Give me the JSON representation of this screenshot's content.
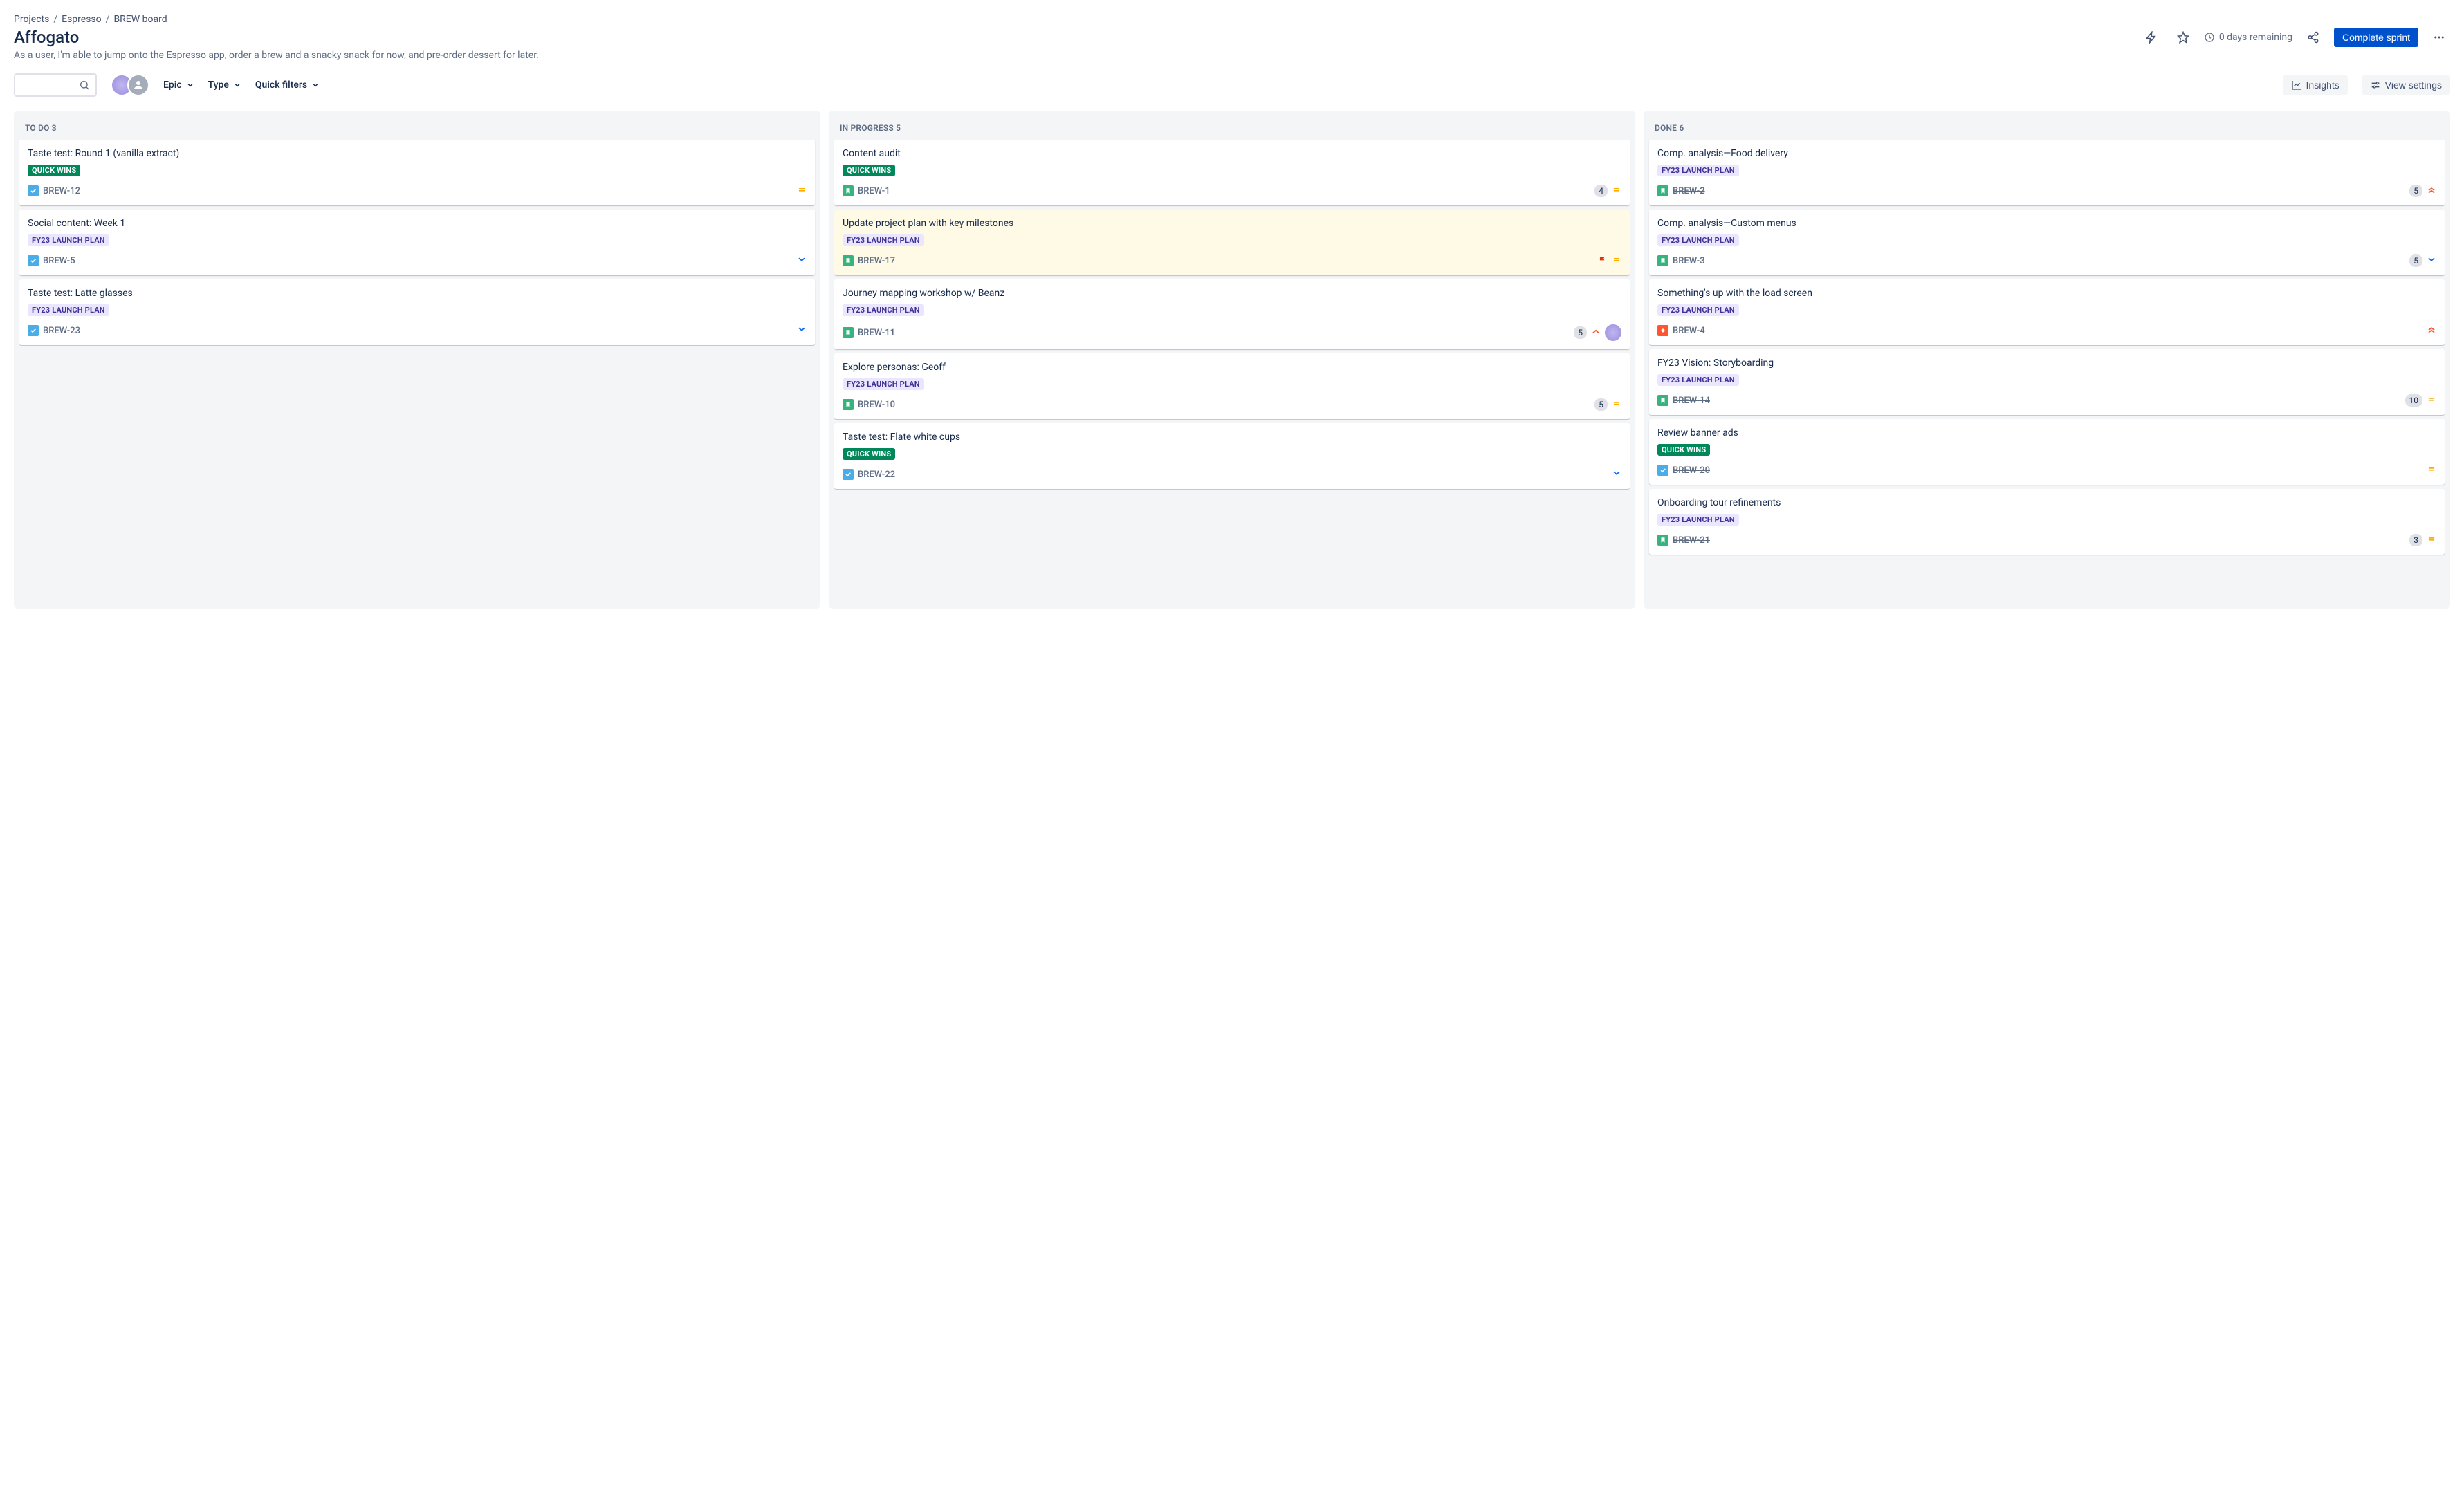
{
  "breadcrumbs": {
    "root": "Projects",
    "project": "Espresso",
    "board": "BREW board"
  },
  "sprint": {
    "name": "Affogato",
    "goal": "As a user, I'm able to jump onto the Espresso app, order a brew and a snacky snack for now, and pre-order dessert for later.",
    "days_remaining": "0 days remaining"
  },
  "actions": {
    "complete_sprint": "Complete sprint",
    "insights": "Insights",
    "view_settings": "View settings"
  },
  "filters": {
    "epic": "Epic",
    "type": "Type",
    "quick": "Quick filters"
  },
  "labels": {
    "quick_wins": "QUICK WINS",
    "launch_plan": "FY23 LAUNCH PLAN"
  },
  "columns": {
    "todo": {
      "name": "TO DO",
      "count": "3"
    },
    "inprogress": {
      "name": "IN PROGRESS",
      "count": "5"
    },
    "done": {
      "name": "DONE",
      "count": "6"
    }
  },
  "cards": {
    "todo": [
      {
        "title": "Taste test: Round 1 (vanilla extract)",
        "label": "quick",
        "key": "BREW-12",
        "type": "task",
        "prio": "medium"
      },
      {
        "title": "Social content: Week 1",
        "label": "launch",
        "key": "BREW-5",
        "type": "task",
        "prio": "low"
      },
      {
        "title": "Taste test: Latte glasses",
        "label": "launch",
        "key": "BREW-23",
        "type": "task",
        "prio": "low"
      }
    ],
    "inprogress": [
      {
        "title": "Content audit",
        "label": "quick",
        "key": "BREW-1",
        "type": "story",
        "prio": "medium",
        "estimate": "4"
      },
      {
        "title": "Update project plan with key milestones",
        "label": "launch",
        "key": "BREW-17",
        "type": "story",
        "prio": "medium",
        "flagged": true
      },
      {
        "title": "Journey mapping workshop w/ Beanz",
        "label": "launch",
        "key": "BREW-11",
        "type": "story",
        "prio": "high",
        "estimate": "5",
        "assignee": true
      },
      {
        "title": "Explore personas: Geoff",
        "label": "launch",
        "key": "BREW-10",
        "type": "story",
        "prio": "medium",
        "estimate": "5"
      },
      {
        "title": "Taste test: Flate white cups",
        "label": "quick",
        "key": "BREW-22",
        "type": "task",
        "prio": "low"
      }
    ],
    "done": [
      {
        "title": "Comp. analysis—Food delivery",
        "label": "launch",
        "key": "BREW-2",
        "type": "story",
        "prio": "highest",
        "estimate": "5"
      },
      {
        "title": "Comp. analysis—Custom menus",
        "label": "launch",
        "key": "BREW-3",
        "type": "story",
        "prio": "low",
        "estimate": "5"
      },
      {
        "title": "Something's up with the load screen",
        "label": "launch",
        "key": "BREW-4",
        "type": "bug",
        "prio": "highest"
      },
      {
        "title": "FY23 Vision: Storyboarding",
        "label": "launch",
        "key": "BREW-14",
        "type": "story",
        "prio": "medium",
        "estimate": "10"
      },
      {
        "title": "Review banner ads",
        "label": "quick",
        "key": "BREW-20",
        "type": "task",
        "prio": "medium"
      },
      {
        "title": "Onboarding tour refinements",
        "label": "launch",
        "key": "BREW-21",
        "type": "story",
        "prio": "medium",
        "estimate": "3"
      }
    ]
  }
}
